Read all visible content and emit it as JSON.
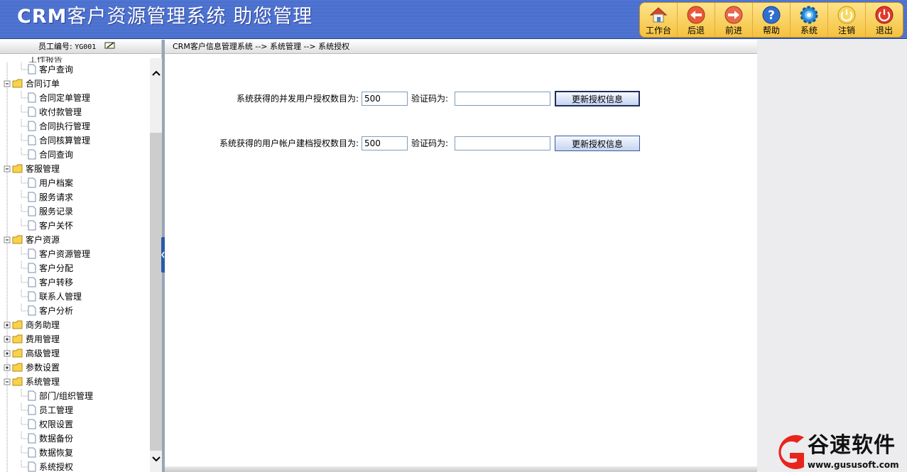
{
  "header": {
    "title_bold": "CRM",
    "title_rest": "客户资源管理系统  助您管理"
  },
  "toolbar": [
    {
      "label": "工作台",
      "icon": "house-icon"
    },
    {
      "label": "后退",
      "icon": "back-arrow-icon"
    },
    {
      "label": "前进",
      "icon": "forward-arrow-icon"
    },
    {
      "label": "帮助",
      "icon": "help-icon"
    },
    {
      "label": "系统",
      "icon": "gear-icon"
    },
    {
      "label": "注销",
      "icon": "logoff-icon"
    },
    {
      "label": "退出",
      "icon": "power-icon"
    }
  ],
  "user": {
    "label": "员工编号:",
    "id": "YG001"
  },
  "tree": {
    "cut_label": "工作报告",
    "items": [
      {
        "label": "客户查询",
        "level": 1
      },
      {
        "label": "合同订单",
        "level": 0
      },
      {
        "label": "合同定单管理",
        "level": 1
      },
      {
        "label": "收付款管理",
        "level": 1
      },
      {
        "label": "合同执行管理",
        "level": 1
      },
      {
        "label": "合同核算管理",
        "level": 1
      },
      {
        "label": "合同查询",
        "level": 1
      },
      {
        "label": "客服管理",
        "level": 0
      },
      {
        "label": "用户档案",
        "level": 1
      },
      {
        "label": "服务请求",
        "level": 1
      },
      {
        "label": "服务记录",
        "level": 1
      },
      {
        "label": "客户关怀",
        "level": 1
      },
      {
        "label": "客户资源",
        "level": 0
      },
      {
        "label": "客户资源管理",
        "level": 1
      },
      {
        "label": "客户分配",
        "level": 1
      },
      {
        "label": "客户转移",
        "level": 1
      },
      {
        "label": "联系人管理",
        "level": 1
      },
      {
        "label": "客户分析",
        "level": 1
      },
      {
        "label": "商务助理",
        "level": 0,
        "collapsed": true
      },
      {
        "label": "费用管理",
        "level": 0,
        "collapsed": true
      },
      {
        "label": "高级管理",
        "level": 0,
        "collapsed": true
      },
      {
        "label": "参数设置",
        "level": 0,
        "collapsed": true
      },
      {
        "label": "系统管理",
        "level": 0
      },
      {
        "label": "部门/组织管理",
        "level": 1
      },
      {
        "label": "员工管理",
        "level": 1
      },
      {
        "label": "权限设置",
        "level": 1
      },
      {
        "label": "数据备份",
        "level": 1
      },
      {
        "label": "数据恢复",
        "level": 1
      },
      {
        "label": "系统授权",
        "level": 1
      }
    ]
  },
  "breadcrumb": "CRM客户信息管理系统 -->  系统管理 --> 系统授权",
  "form": {
    "row1": {
      "label": "系统获得的并发用户授权数目为:",
      "value": "500",
      "code_label": "验证码为:",
      "code_value": "",
      "button": "更新授权信息"
    },
    "row2": {
      "label": "系统获得的用户帐户建档授权数目为:",
      "value": "500",
      "code_label": "验证码为:",
      "code_value": "",
      "button": "更新授权信息"
    }
  },
  "brand": {
    "name": "谷速软件",
    "url": "www.gususoft.com",
    "color": "#e8241c"
  }
}
